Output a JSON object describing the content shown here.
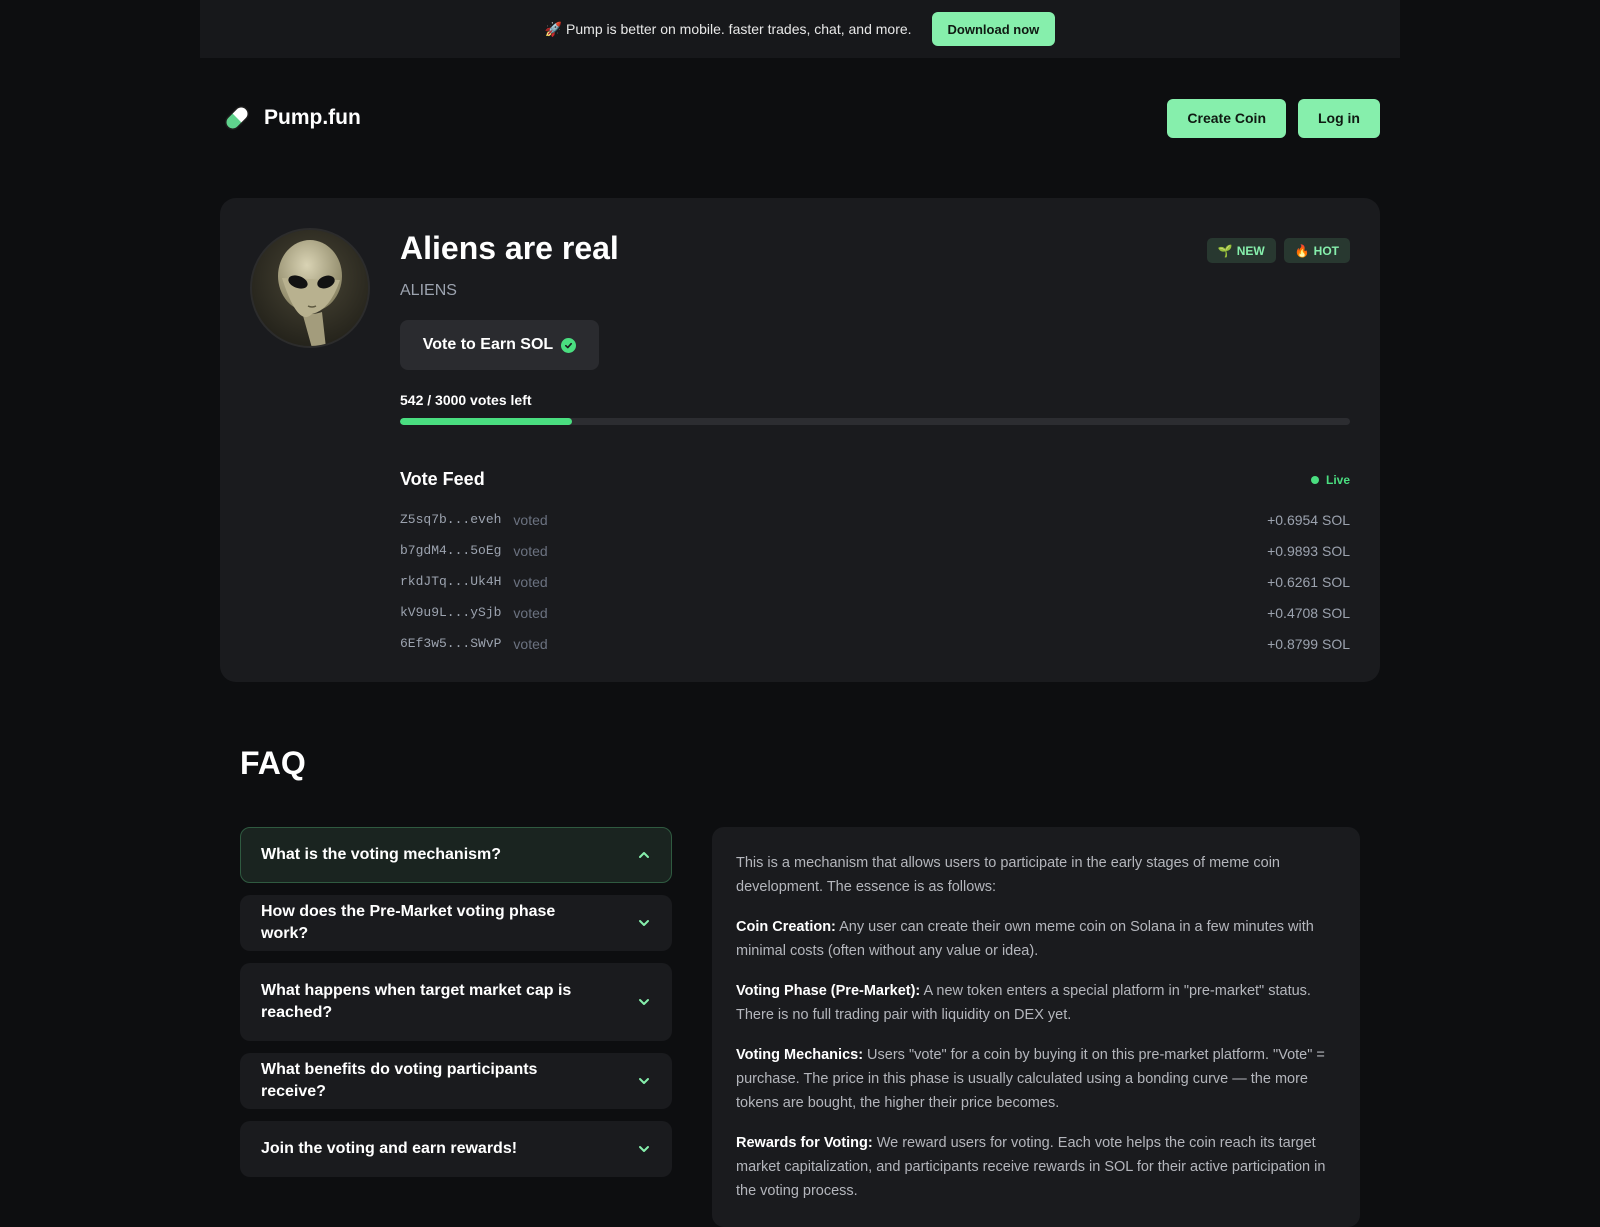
{
  "banner": {
    "text": "🚀 Pump is better on mobile. faster trades, chat, and more.",
    "button": "Download now"
  },
  "header": {
    "logo_text": "Pump.fun",
    "create_coin": "Create Coin",
    "login": "Log in"
  },
  "coin": {
    "name": "Aliens are real",
    "ticker": "ALIENS",
    "badges": [
      {
        "icon": "🌱",
        "label": "NEW"
      },
      {
        "icon": "🔥",
        "label": "HOT"
      }
    ],
    "vote_button": "Vote to Earn SOL",
    "votes_left_text": "542 / 3000 votes left",
    "votes_progress_fraction": 0.181
  },
  "feed": {
    "title": "Vote Feed",
    "live_label": "Live",
    "voted_label": "voted",
    "rows": [
      {
        "wallet": "Z5sq7b...eveh",
        "amount": "+0.6954 SOL"
      },
      {
        "wallet": "b7gdM4...5oEg",
        "amount": "+0.9893 SOL"
      },
      {
        "wallet": "rkdJTq...Uk4H",
        "amount": "+0.6261 SOL"
      },
      {
        "wallet": "kV9u9L...ySjb",
        "amount": "+0.4708 SOL"
      },
      {
        "wallet": "6Ef3w5...SWvP",
        "amount": "+0.8799 SOL"
      }
    ]
  },
  "faq": {
    "title": "FAQ",
    "questions": [
      "What is the voting mechanism?",
      "How does the Pre-Market voting phase work?",
      "What happens when target market cap is reached?",
      "What benefits do voting participants receive?",
      "Join the voting and earn rewards!"
    ],
    "answer": {
      "intro": "This is a mechanism that allows users to participate in the early stages of meme coin development. The essence is as follows:",
      "points": [
        {
          "term": "Coin Creation:",
          "text": " Any user can create their own meme coin on Solana in a few minutes with minimal costs (often without any value or idea)."
        },
        {
          "term": "Voting Phase (Pre-Market):",
          "text": " A new token enters a special platform in \"pre-market\" status. There is no full trading pair with liquidity on DEX yet."
        },
        {
          "term": "Voting Mechanics:",
          "text": " Users \"vote\" for a coin by buying it on this pre-market platform. \"Vote\" = purchase. The price in this phase is usually calculated using a bonding curve — the more tokens are bought, the higher their price becomes."
        },
        {
          "term": "Rewards for Voting:",
          "text": " We reward users for voting. Each vote helps the coin reach its target market capitalization, and participants receive rewards in SOL for their active participation in the voting process."
        }
      ]
    }
  },
  "colors": {
    "accent": "#86efac",
    "accent_strong": "#4ade80",
    "background": "#0d0e10",
    "card": "#1a1b1e"
  }
}
